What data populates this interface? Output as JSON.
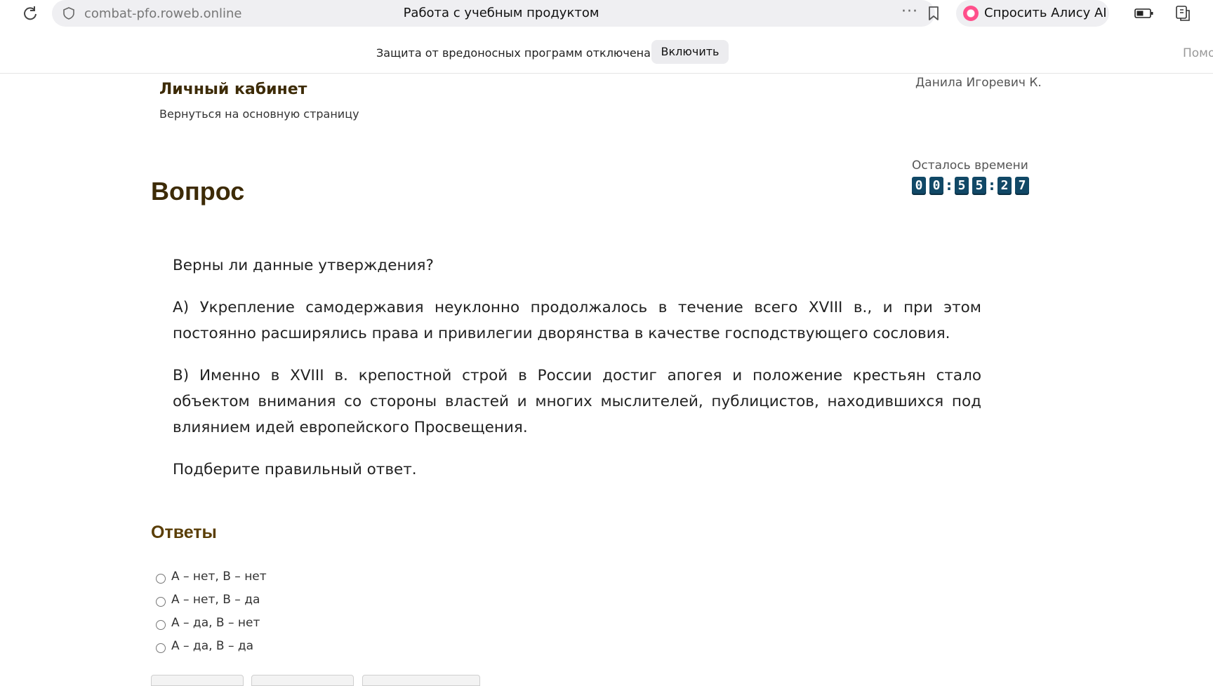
{
  "browser": {
    "url": "combat-pfo.roweb.online",
    "tab_title": "Работа с учебным продуктом",
    "more_label": "···",
    "alice_label": "Спросить Алису AI"
  },
  "notice": {
    "message": "Защита от вредоносных программ отключена",
    "enable_label": "Включить",
    "help_label": "Помощь"
  },
  "header": {
    "cabinet_title": "Личный кабинет",
    "back_link": "Вернуться на основную страницу",
    "user_name": "Данила Игоревич К."
  },
  "timer": {
    "label": "Осталось времени",
    "digits": [
      "0",
      "0",
      "5",
      "5",
      "2",
      "7"
    ],
    "separator": ":"
  },
  "question": {
    "heading": "Вопрос",
    "paragraphs": [
      "Верны ли данные утверждения?",
      "А) Укрепление самодержавия неуклонно продолжалось в течение всего XVIII в., и при этом постоянно расширялись права и привилегии дворянства в качестве господствующего сословия.",
      "В) Именно в XVIII в. крепостной строй в России достиг апогея и положение крестьян стало объектом внимания со стороны властей и многих мыслителей, публицистов, находившихся под влиянием идей европейского Просвещения.",
      "Подберите правильный ответ."
    ]
  },
  "answers": {
    "heading": "Ответы",
    "options": [
      "А – нет, В – нет",
      "А – нет, В – да",
      "А – да, В – нет",
      "А – да, В – да"
    ]
  }
}
